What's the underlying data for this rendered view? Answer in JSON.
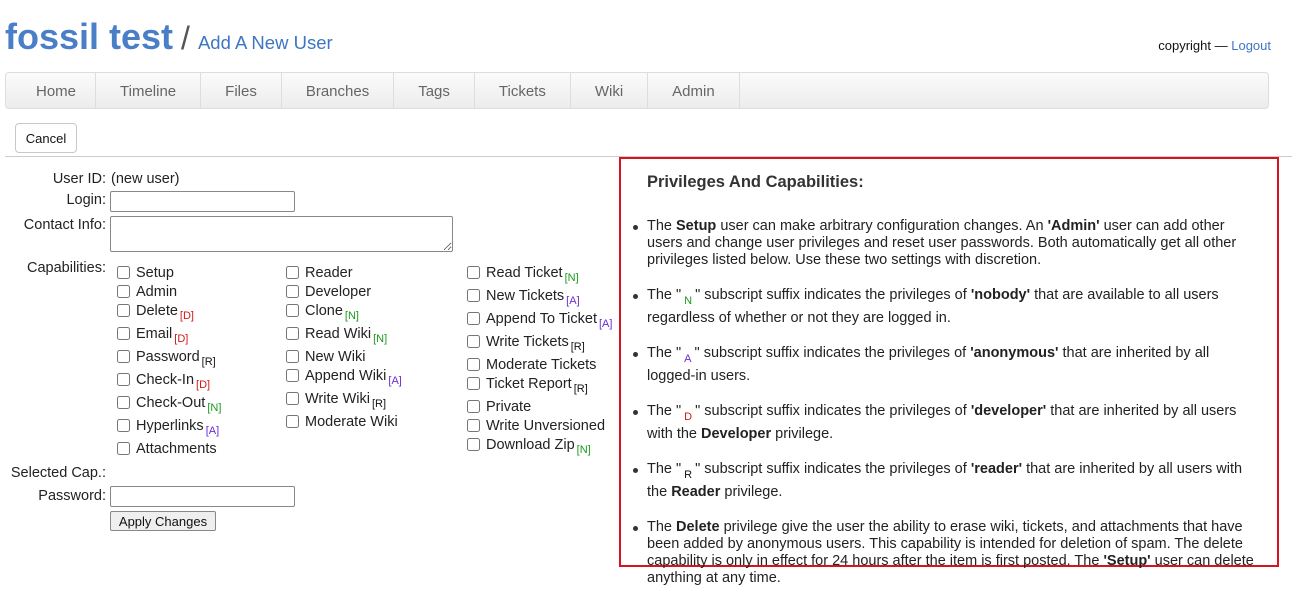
{
  "header": {
    "project_name": "fossil test",
    "separator": "/",
    "page_title": "Add A New User",
    "copyright": "copyright — ",
    "logout": "Logout"
  },
  "menu": [
    "Home",
    "Timeline",
    "Files",
    "Branches",
    "Tags",
    "Tickets",
    "Wiki",
    "Admin"
  ],
  "cancel_label": "Cancel",
  "form": {
    "user_id_label": "User ID:",
    "user_id_value": "(new user)",
    "login_label": "Login:",
    "login_value": "",
    "contact_label": "Contact Info:",
    "contact_value": "",
    "capabilities_label": "Capabilities:",
    "selected_cap_label": "Selected Cap.:",
    "selected_cap_value": "",
    "password_label": "Password:",
    "password_value": "",
    "apply_label": "Apply Changes"
  },
  "capabilities": [
    [
      {
        "label": "Setup",
        "sub": "",
        "checked": false
      },
      {
        "label": "Admin",
        "sub": "",
        "checked": false
      },
      {
        "label": "Delete",
        "sub": "[D]",
        "checked": false
      },
      {
        "label": "Email",
        "sub": "[D]",
        "checked": false
      },
      {
        "label": "Password",
        "sub": "[R]",
        "checked": false
      },
      {
        "label": "Check-In",
        "sub": "[D]",
        "checked": false
      },
      {
        "label": "Check-Out",
        "sub": "[N]",
        "checked": false
      },
      {
        "label": "Hyperlinks",
        "sub": "[A]",
        "checked": false
      },
      {
        "label": "Attachments",
        "sub": "",
        "checked": false
      }
    ],
    [
      {
        "label": "Reader",
        "sub": "",
        "checked": false
      },
      {
        "label": "Developer",
        "sub": "",
        "checked": false
      },
      {
        "label": "Clone",
        "sub": "[N]",
        "checked": false
      },
      {
        "label": "Read Wiki",
        "sub": "[N]",
        "checked": false
      },
      {
        "label": "New Wiki",
        "sub": "",
        "checked": false
      },
      {
        "label": "Append Wiki",
        "sub": "[A]",
        "checked": false
      },
      {
        "label": "Write Wiki",
        "sub": "[R]",
        "checked": false
      },
      {
        "label": "Moderate Wiki",
        "sub": "",
        "checked": false
      }
    ],
    [
      {
        "label": "Read Ticket",
        "sub": "[N]",
        "checked": false
      },
      {
        "label": "New Tickets",
        "sub": "[A]",
        "checked": false
      },
      {
        "label": "Append To Ticket",
        "sub": "[A]",
        "checked": false
      },
      {
        "label": "Write Tickets",
        "sub": "[R]",
        "checked": false
      },
      {
        "label": "Moderate Tickets",
        "sub": "",
        "checked": false
      },
      {
        "label": "Ticket Report",
        "sub": "[R]",
        "checked": false
      },
      {
        "label": "Private",
        "sub": "",
        "checked": false
      },
      {
        "label": "Write Unversioned",
        "sub": "",
        "checked": false
      },
      {
        "label": "Download Zip",
        "sub": "[N]",
        "checked": false
      }
    ]
  ],
  "sub_colors": {
    "N": "#1a9a1a",
    "A": "#6a2bd6",
    "D": "#d01818",
    "R": "#111111"
  },
  "info": {
    "title": "Privileges And Capabilities:",
    "items": [
      [
        [
          "t",
          "The "
        ],
        [
          "b",
          "Setup"
        ],
        [
          "t",
          " user can make arbitrary configuration changes. An "
        ],
        [
          "b",
          "'Admin'"
        ],
        [
          "t",
          " user can add other users and change user privileges and reset user passwords. Both automatically get all other privileges listed below. Use these two settings with discretion."
        ]
      ],
      [
        [
          "t",
          "The \""
        ],
        [
          "N",
          "N"
        ],
        [
          "t",
          "\" subscript suffix indicates the privileges of "
        ],
        [
          "b",
          "'nobody'"
        ],
        [
          "t",
          " that are available to all users regardless of whether or not they are logged in."
        ]
      ],
      [
        [
          "t",
          "The \""
        ],
        [
          "A",
          "A"
        ],
        [
          "t",
          "\" subscript suffix indicates the privileges of "
        ],
        [
          "b",
          "'anonymous'"
        ],
        [
          "t",
          " that are inherited by all logged-in users."
        ]
      ],
      [
        [
          "t",
          "The \""
        ],
        [
          "D",
          "D"
        ],
        [
          "t",
          "\" subscript suffix indicates the privileges of "
        ],
        [
          "b",
          "'developer'"
        ],
        [
          "t",
          " that are inherited by all users with the "
        ],
        [
          "b",
          "Developer"
        ],
        [
          "t",
          " privilege."
        ]
      ],
      [
        [
          "t",
          "The \""
        ],
        [
          "R",
          "R"
        ],
        [
          "t",
          "\" subscript suffix indicates the privileges of "
        ],
        [
          "b",
          "'reader'"
        ],
        [
          "t",
          " that are inherited by all users with the "
        ],
        [
          "b",
          "Reader"
        ],
        [
          "t",
          " privilege."
        ]
      ],
      [
        [
          "t",
          "The "
        ],
        [
          "b",
          "Delete"
        ],
        [
          "t",
          " privilege give the user the ability to erase wiki, tickets, and attachments that have been added by anonymous users. This capability is intended for deletion of spam. The delete capability is only in effect for 24 hours after the item is first posted. The "
        ],
        [
          "b",
          "'Setup'"
        ],
        [
          "t",
          " user can delete anything at any time."
        ]
      ]
    ]
  }
}
